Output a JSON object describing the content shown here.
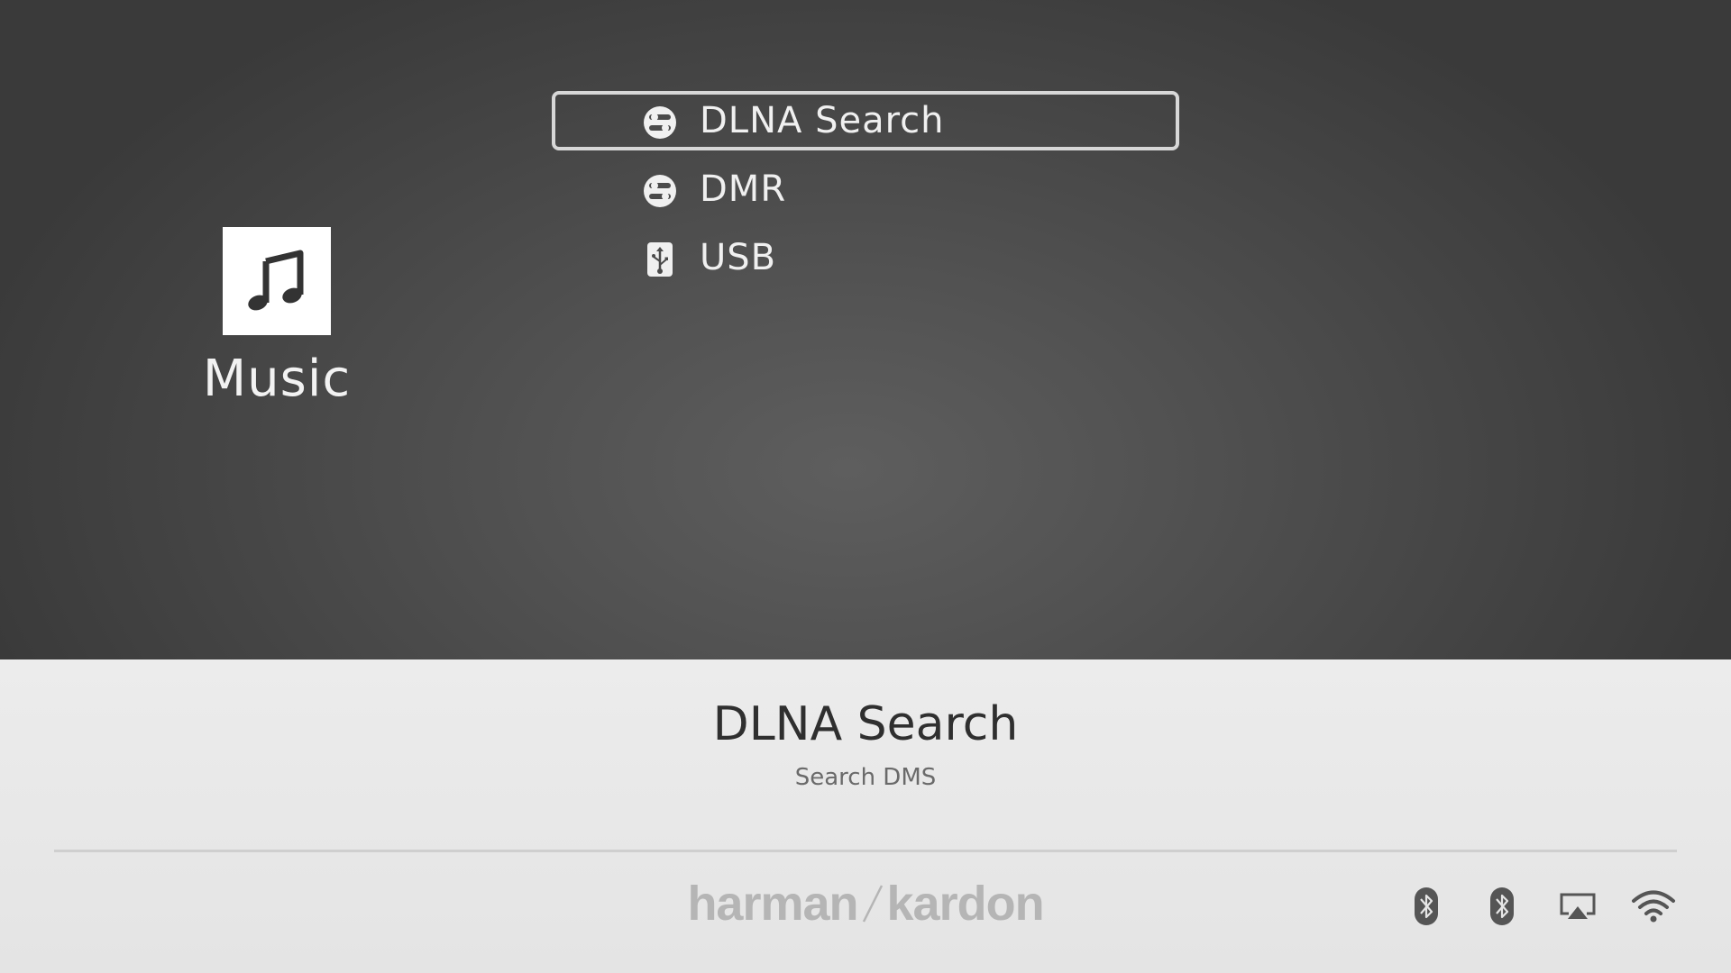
{
  "source": {
    "label": "Music",
    "icon": "music-note-icon"
  },
  "menu": {
    "items": [
      {
        "label": "DLNA Search",
        "icon": "network-icon",
        "selected": true
      },
      {
        "label": "DMR",
        "icon": "network-icon",
        "selected": false
      },
      {
        "label": "USB",
        "icon": "usb-icon",
        "selected": false
      }
    ]
  },
  "info": {
    "title": "DLNA Search",
    "subtitle": "Search DMS"
  },
  "footer": {
    "brand_left": "harman",
    "brand_right": "kardon",
    "status_icons": [
      "bluetooth-icon",
      "bluetooth-icon",
      "airplay-icon",
      "wifi-icon"
    ]
  },
  "colors": {
    "selection_border": "#d7d7d7",
    "panel_background": "#e8e8e8",
    "brand": "#b5b5b5"
  }
}
